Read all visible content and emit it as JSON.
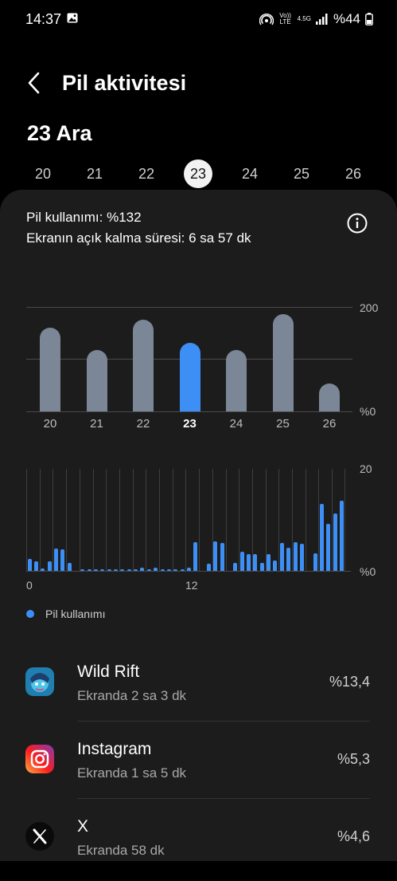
{
  "status_bar": {
    "time": "14:37",
    "network_top": "4.5G",
    "volte": "Vo)) LTE",
    "battery": "%44"
  },
  "header": {
    "title": "Pil aktivitesi"
  },
  "date_title": "23 Ara",
  "day_selector": [
    "20",
    "21",
    "22",
    "23",
    "24",
    "25",
    "26"
  ],
  "selected_day": "23",
  "summary": {
    "battery_usage": "Pil kullanımı: %132",
    "screen_time": "Ekranın açık kalma süresi: 6 sa 57 dk"
  },
  "chart_data": [
    {
      "type": "bar",
      "categories": [
        "20",
        "21",
        "22",
        "23",
        "24",
        "25",
        "26"
      ],
      "values": [
        160,
        117,
        176,
        131,
        118,
        186,
        54
      ],
      "highlighted": "23",
      "ylim": [
        0,
        200
      ],
      "y_tick_labels": [
        "200",
        "%0"
      ],
      "colors": {
        "bar": "#7b8696",
        "highlight": "#3d8ff5"
      }
    },
    {
      "type": "bar",
      "x_tick_labels": [
        "0",
        "12"
      ],
      "y_tick_labels": [
        "20",
        "%0"
      ],
      "ylim": [
        0,
        20
      ],
      "legend": [
        "Pil kullanımı"
      ],
      "color": "#3d8ff5",
      "values": [
        2.4,
        1.8,
        0.4,
        1.8,
        4.4,
        4.2,
        1.5,
        0,
        0.3,
        0.3,
        0.3,
        0.3,
        0.3,
        0.3,
        0.3,
        0.3,
        0.3,
        0.6,
        0.3,
        0.6,
        0.3,
        0.3,
        0.3,
        0.3,
        0.6,
        5.6,
        0,
        1.4,
        5.8,
        5.5,
        0,
        1.5,
        3.8,
        3.3,
        3.3,
        1.5,
        3.3,
        2.0,
        5.4,
        4.5,
        5.6,
        5.3,
        0,
        3.5,
        13.2,
        9.2,
        11.3,
        13.8
      ]
    }
  ],
  "legend_label": "Pil kullanımı",
  "apps": [
    {
      "name": "Wild Rift",
      "screen": "Ekranda 2 sa 3 dk",
      "percent": "%13,4",
      "icon": "wild-rift-icon"
    },
    {
      "name": "Instagram",
      "screen": "Ekranda 1 sa 5 dk",
      "percent": "%5,3",
      "icon": "instagram-icon"
    },
    {
      "name": "X",
      "screen": "Ekranda 58 dk",
      "percent": "%4,6",
      "icon": "x-icon"
    }
  ]
}
